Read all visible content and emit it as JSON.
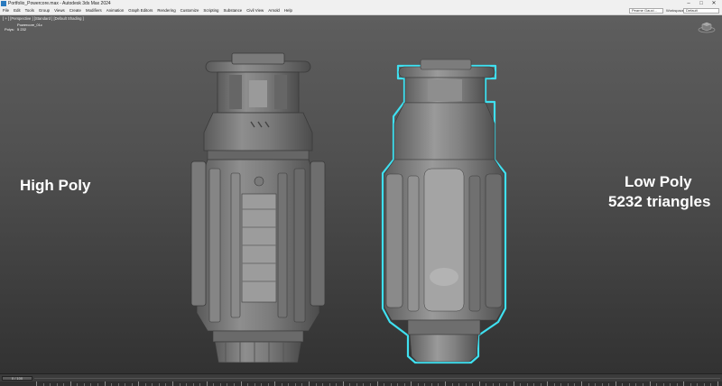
{
  "window": {
    "title": "Portfolio_Powercore.max - Autodesk 3ds Max 2024",
    "buttons": [
      "–",
      "□",
      "✕"
    ]
  },
  "menu": {
    "items": [
      "File",
      "Edit",
      "Tools",
      "Group",
      "Views",
      "Create",
      "Modifiers",
      "Animation",
      "Graph Editors",
      "Rendering",
      "Customize",
      "Scripting",
      "Substance",
      "Civil View",
      "Arnold",
      "Help"
    ],
    "signin": "Pearne Gauci...",
    "workspaces_label": "Workspaces:",
    "workspaces_value": "Default"
  },
  "viewport": {
    "label": "[ + ] [Perspective ] [Standard ] [Default Shading ]",
    "stats": {
      "object_label": "Powercore_01c",
      "polys_label": "Polys:",
      "polys_value": "5 232"
    }
  },
  "annotations": {
    "left": "High Poly",
    "right_line1": "Low Poly",
    "right_line2": "5232 triangles"
  },
  "timeline": {
    "slider": "0 / 100"
  },
  "colors": {
    "selection_outline": "#3fe0f0",
    "model": "#8f8f8f",
    "viewport_bg": "#505050"
  },
  "icons": [
    "application-icon",
    "minimize-icon",
    "maximize-icon",
    "close-icon",
    "viewcube-icon"
  ]
}
